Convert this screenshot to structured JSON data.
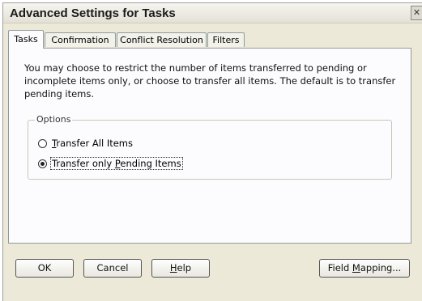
{
  "window": {
    "title": "Advanced Settings for Tasks",
    "close_glyph": "✕"
  },
  "tabs": [
    {
      "label": "Tasks",
      "active": true
    },
    {
      "label": "Confirmation",
      "active": false
    },
    {
      "label": "Conflict Resolution",
      "active": false
    },
    {
      "label": "Filters",
      "active": false
    }
  ],
  "panel": {
    "description": "You may choose to restrict the number of items transferred to pending or incomplete items only, or choose to transfer all items.  The default is to transfer pending items.",
    "options_group": {
      "label": "Options",
      "radios": [
        {
          "mnemonic": "T",
          "rest": "ransfer All Items",
          "checked": false
        },
        {
          "prefix": "Transfer only ",
          "mnemonic": "P",
          "rest": "ending Items",
          "checked": true
        }
      ]
    }
  },
  "buttons": {
    "ok": "OK",
    "cancel": "Cancel",
    "help_mnemonic": "H",
    "help_rest": "elp",
    "field_mapping_prefix": "Field ",
    "field_mapping_mnemonic": "M",
    "field_mapping_rest": "apping..."
  }
}
